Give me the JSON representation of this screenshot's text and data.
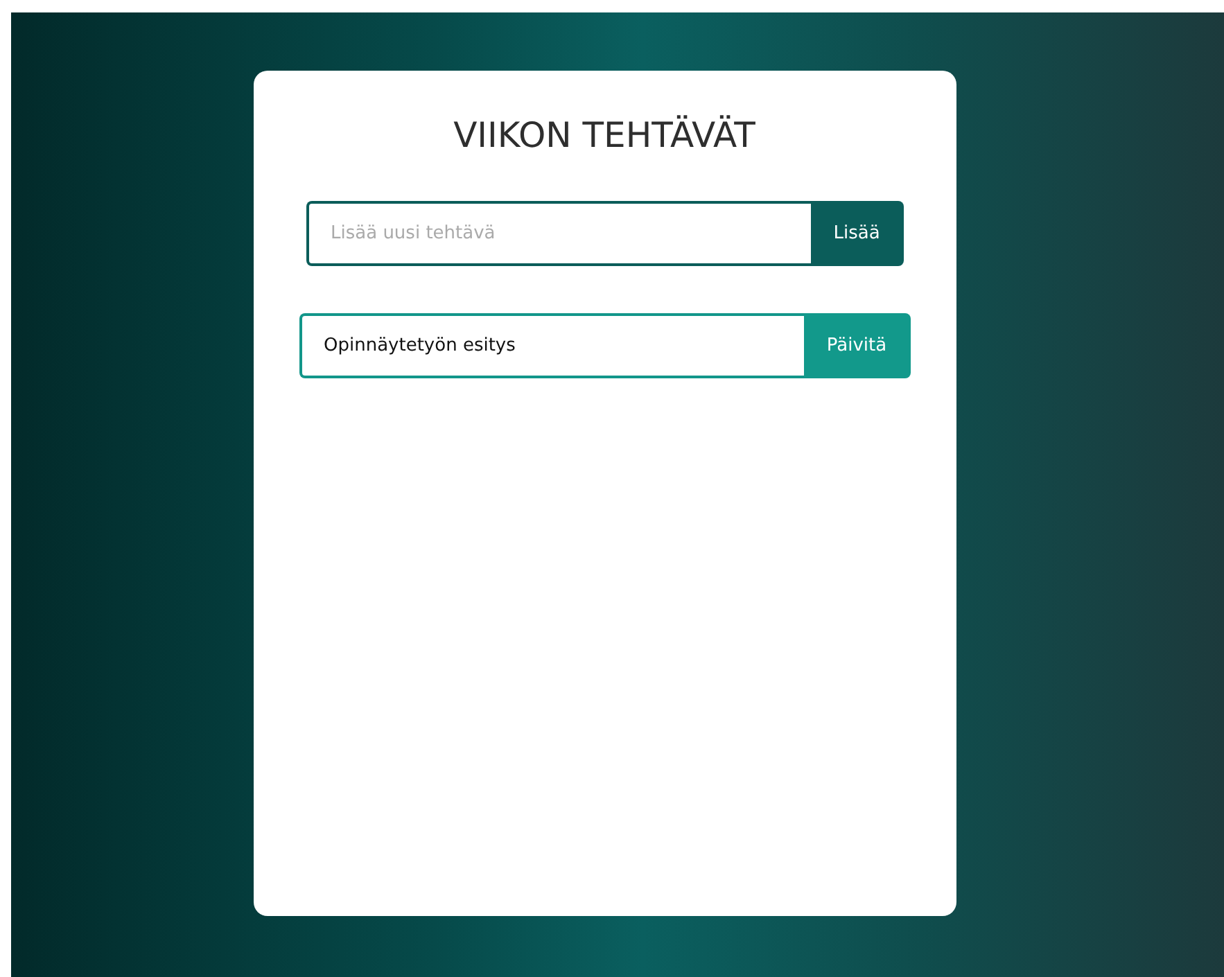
{
  "title": "VIIKON TEHTÄVÄT",
  "new_task": {
    "placeholder": "Lisää uusi tehtävä",
    "button": "Lisää"
  },
  "tasks": [
    {
      "kind": "editing",
      "value": "Opinnäytetyön esitys",
      "button": "Päivitä"
    }
  ]
}
